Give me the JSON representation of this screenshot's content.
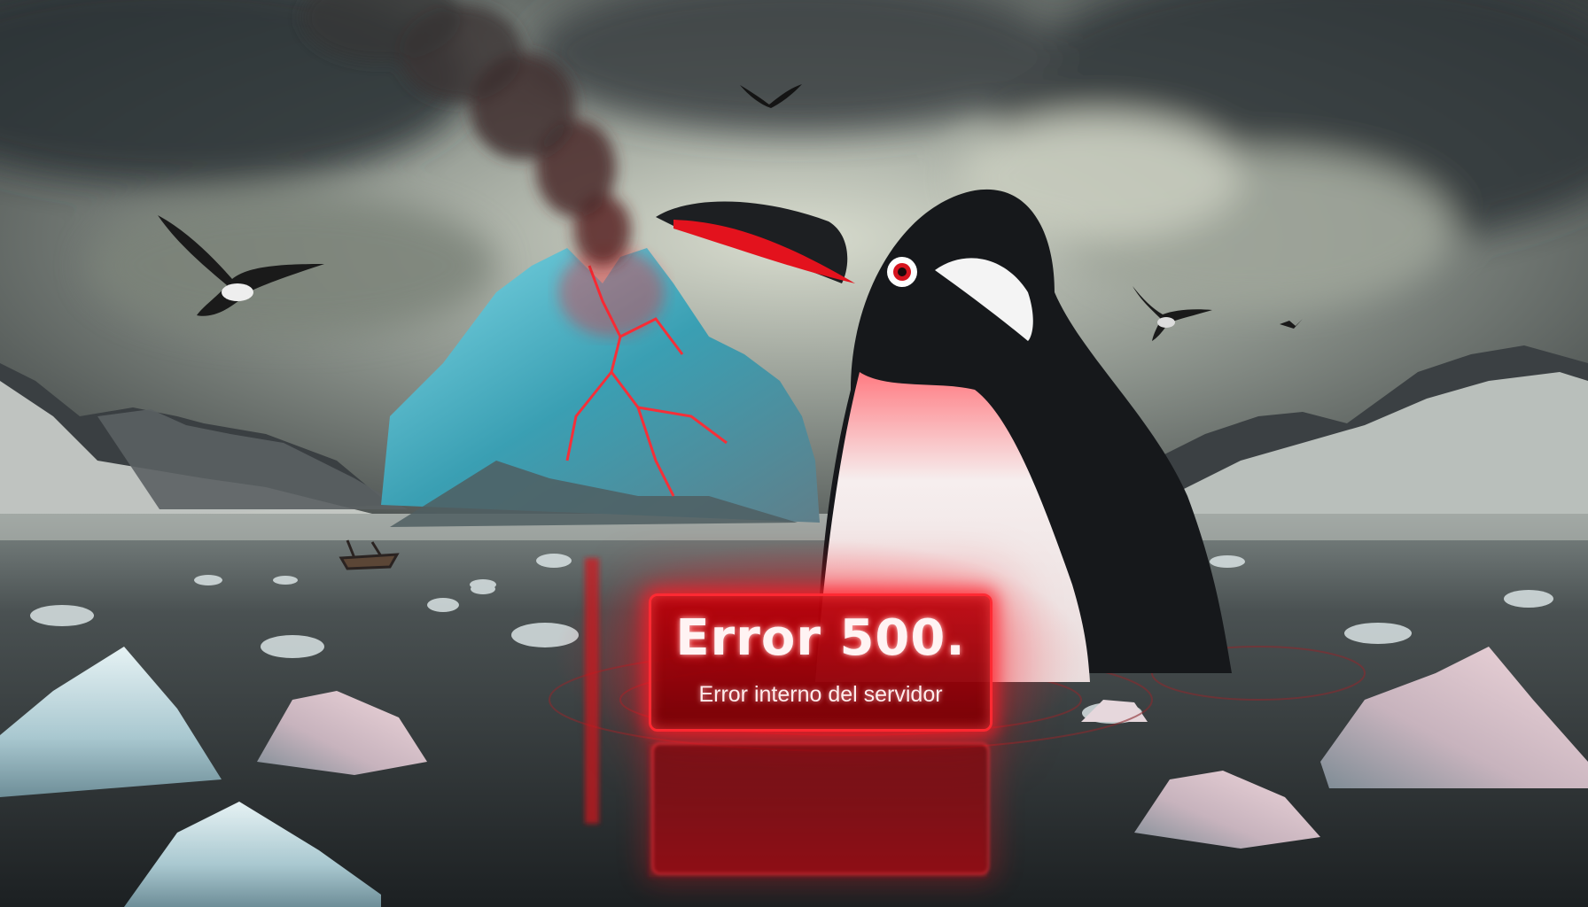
{
  "sign": {
    "title": "Error 500.",
    "subtitle": "Error interno del servidor"
  },
  "colors": {
    "sky": "#3b4446",
    "water": "#2f3436",
    "penguin_black": "#16181b",
    "beak_red": "#e3121d",
    "glow_red": "#ff2a33",
    "iceberg_blue": "#3fb6c9"
  }
}
